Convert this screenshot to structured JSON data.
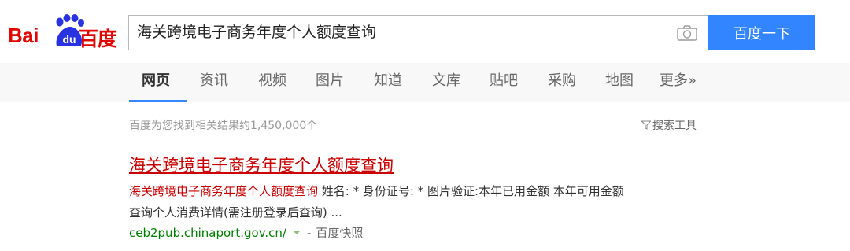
{
  "brand": {
    "logo_left": "Bai",
    "logo_mid": "du",
    "logo_right": "百度"
  },
  "search": {
    "query": "海关跨境电子商务年度个人额度查询",
    "button_label": "百度一下"
  },
  "tabs": [
    {
      "label": "网页",
      "active": true
    },
    {
      "label": "资讯"
    },
    {
      "label": "视频"
    },
    {
      "label": "图片"
    },
    {
      "label": "知道"
    },
    {
      "label": "文库"
    },
    {
      "label": "贴吧"
    },
    {
      "label": "采购"
    },
    {
      "label": "地图"
    },
    {
      "label": "更多»"
    }
  ],
  "results_meta": {
    "count_text": "百度为您找到相关结果约1,450,000个",
    "tools_label": "搜索工具"
  },
  "result": {
    "title": "海关跨境电子商务年度个人额度查询",
    "snippet_highlight": "海关跨境电子商务年度个人额度查询",
    "snippet_rest": " 姓名: * 身份证号: * 图片验证:本年已用金额 本年可用金额",
    "snippet_line2": "查询个人消费详情(需注册登录后查询) ...",
    "url": "ceb2pub.chinaport.gov.cn/",
    "separator": "-",
    "snapshot_label": "百度快照"
  },
  "colors": {
    "brand_red": "#e10601",
    "accent_blue": "#3385ff",
    "link_red": "#cc0000",
    "url_green": "#008000"
  }
}
